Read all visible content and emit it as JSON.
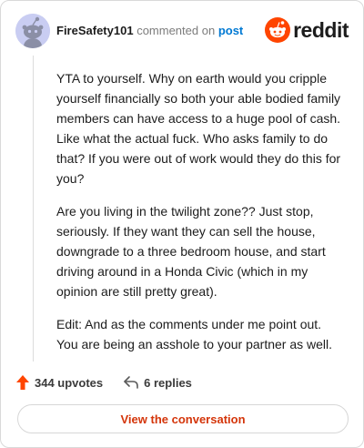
{
  "header": {
    "username": "FireSafety101",
    "action": "commented on",
    "post_link": "post",
    "logo_text": "reddit"
  },
  "comment": {
    "paragraphs": [
      "YTA to yourself. Why on earth would you cripple yourself financially so both your able bodied family members can have access to a huge pool of cash. Like what the actual fuck. Who asks family to do that? If you were out of work would they do this for you?",
      "Are you living in the twilight zone?? Just stop, seriously. If they want they can sell the house, downgrade to a three bedroom house, and start driving around in a Honda Civic (which in my opinion are still pretty great).",
      "Edit: And as the comments under me point out. You are being an asshole to your partner as well."
    ]
  },
  "footer": {
    "upvotes": "344 upvotes",
    "replies": "6 replies"
  },
  "cta": {
    "label": "View the conversation"
  },
  "colors": {
    "accent": "#ff4500",
    "link": "#0079d3",
    "cta_text": "#d4350a"
  },
  "icons": {
    "avatar": "snoo-avatar-icon",
    "logo": "reddit-logo-icon",
    "upvote": "upvote-arrow-icon",
    "reply": "reply-arrow-icon"
  }
}
